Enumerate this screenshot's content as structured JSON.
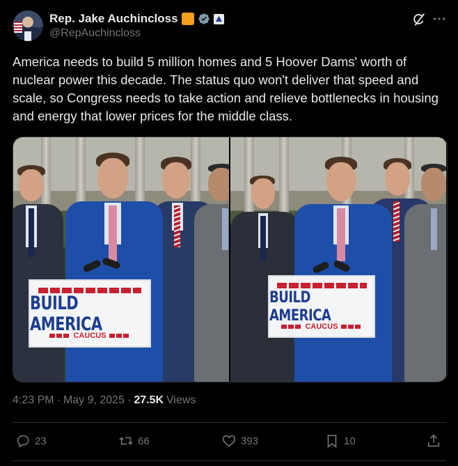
{
  "author": {
    "name": "Rep. Jake Auchincloss",
    "handle": "@RepAuchincloss"
  },
  "tweet": {
    "text": "America needs to build 5 million homes and 5 Hoover Dams' worth of nuclear power this decade. The status quo won't deliver that speed and scale, so Congress needs to take action and relieve bottlenecks in housing and energy that lower prices for the middle class."
  },
  "media": {
    "sign_line1": "BUILD AMERICA",
    "sign_line2": "CAUCUS"
  },
  "meta": {
    "time": "4:23 PM",
    "sep1": "·",
    "date": "May 9, 2025",
    "sep2": "·",
    "views_count": "27.5K",
    "views_label": "Views"
  },
  "actions": {
    "replies": "23",
    "reposts": "66",
    "likes": "393",
    "bookmarks": "10"
  },
  "colors": {
    "background": "#000000",
    "text": "#e7e9ea",
    "muted": "#71767b",
    "border": "#2f3336",
    "verified": "#829aab",
    "orange_badge": "#f59f1b"
  },
  "icons": [
    "grok-icon",
    "more-icon",
    "verified-icon",
    "government-badge-icon",
    "reply-icon",
    "repost-icon",
    "like-icon",
    "bookmark-icon",
    "share-icon"
  ]
}
